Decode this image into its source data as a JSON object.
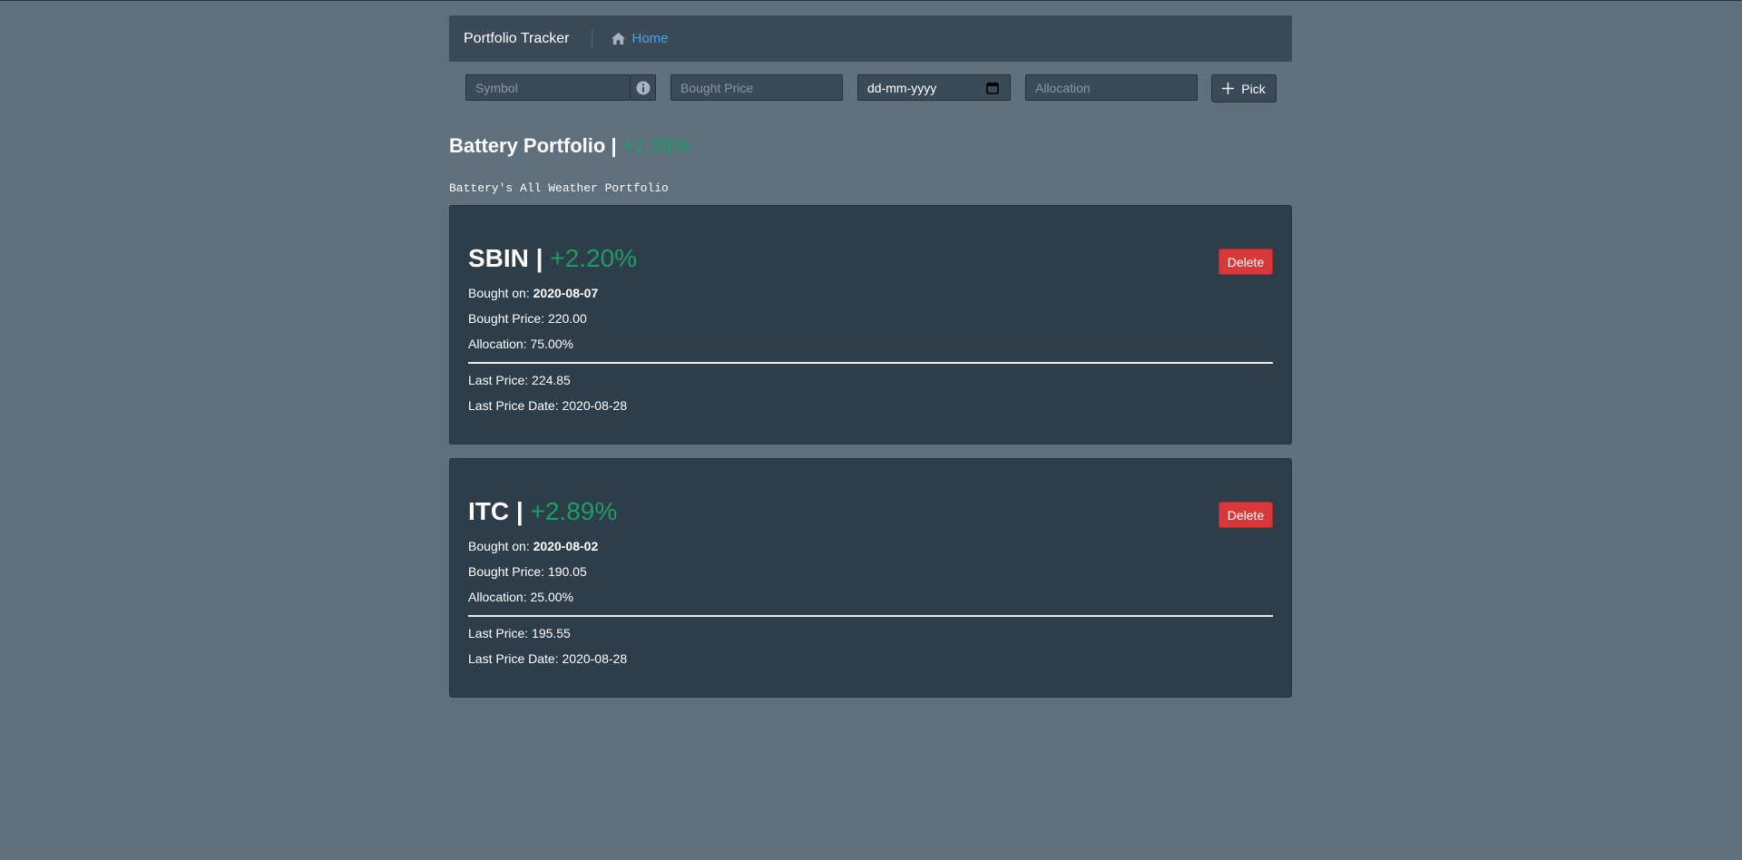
{
  "navbar": {
    "brand": "Portfolio Tracker",
    "home_label": "Home"
  },
  "form": {
    "symbol_placeholder": "Symbol",
    "bought_price_placeholder": "Bought Price",
    "date_placeholder": "dd-mm-yyyy",
    "allocation_placeholder": "Allocation",
    "pick_label": "Pick"
  },
  "portfolio": {
    "name": "Battery Portfolio |",
    "change": "+2.38%",
    "description": "Battery's All Weather Portfolio"
  },
  "stocks": [
    {
      "symbol": "SBIN |",
      "change": "+2.20%",
      "bought_on_label": "Bought on:",
      "bought_on": "2020-08-07",
      "bought_price": "Bought Price: 220.00",
      "allocation": "Allocation: 75.00%",
      "last_price": "Last Price: 224.85",
      "last_price_date": "Last Price Date: 2020-08-28",
      "delete_label": "Delete"
    },
    {
      "symbol": "ITC |",
      "change": "+2.89%",
      "bought_on_label": "Bought on:",
      "bought_on": "2020-08-02",
      "bought_price": "Bought Price: 190.05",
      "allocation": "Allocation: 25.00%",
      "last_price": "Last Price: 195.55",
      "last_price_date": "Last Price Date: 2020-08-28",
      "delete_label": "Delete"
    }
  ],
  "colors": {
    "background": "#5e6f7e",
    "panel": "#3a4a58",
    "card": "#2e3d4a",
    "positive": "#1c9e63",
    "link": "#4aa3e6",
    "danger": "#d9383a"
  },
  "icons": {
    "home": "home-icon",
    "info": "info-icon",
    "calendar": "calendar-icon",
    "plus": "plus-icon"
  }
}
